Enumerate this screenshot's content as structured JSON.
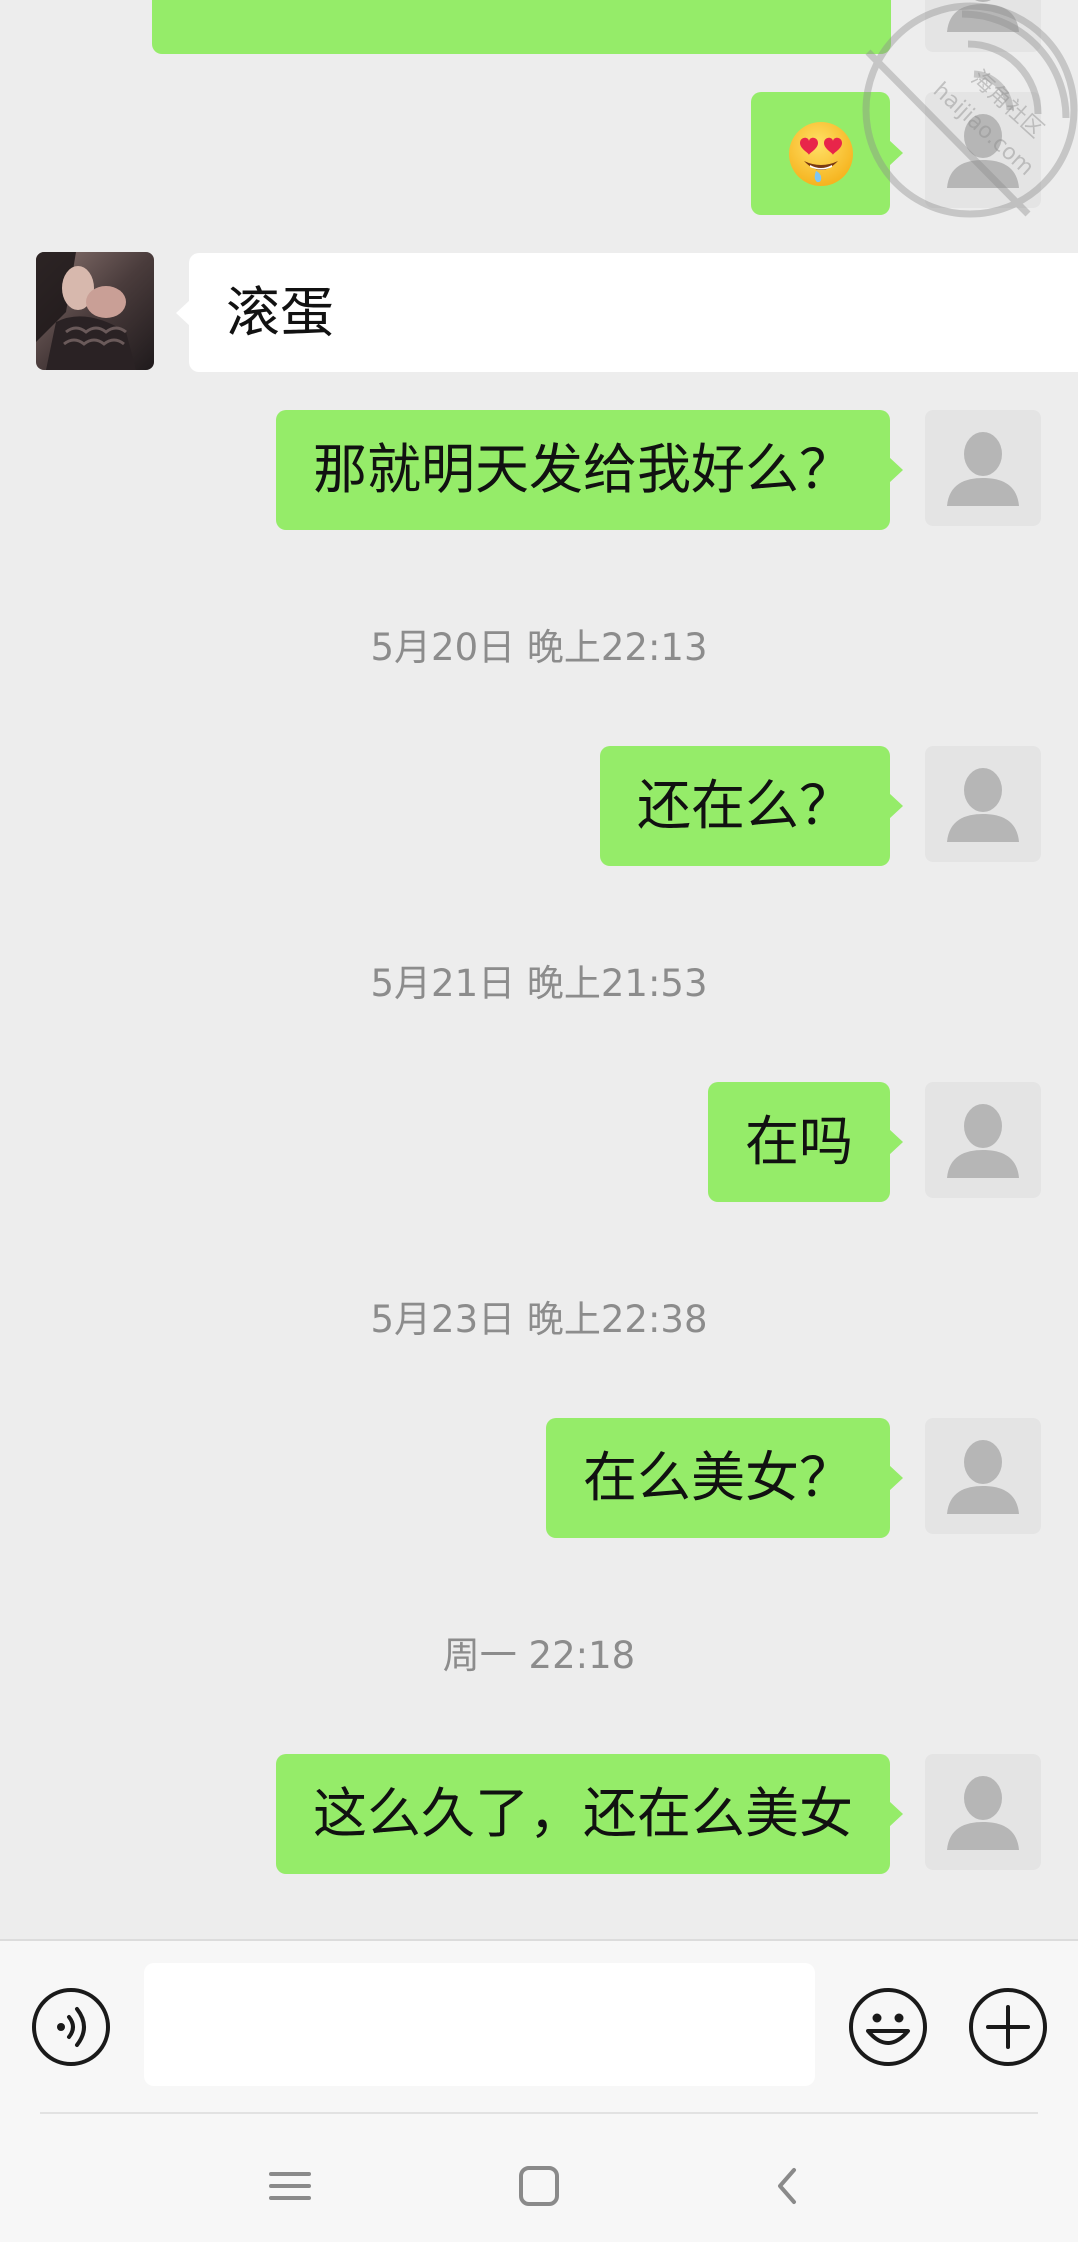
{
  "colors": {
    "background": "#ededed",
    "sent_bubble": "#95ec69",
    "received_bubble": "#ffffff",
    "timestamp": "#8c8c8c",
    "input_bar": "#f7f7f7"
  },
  "chat": {
    "messages": [
      {
        "side": "right",
        "type": "sticker",
        "icon": "heart-eyes-drool-emoji"
      },
      {
        "side": "left",
        "type": "text",
        "text": "滚蛋"
      },
      {
        "side": "right",
        "type": "text",
        "text": "那就明天发给我好么？"
      },
      {
        "type": "time",
        "text": "5月20日 晚上22:13"
      },
      {
        "side": "right",
        "type": "text",
        "text": "还在么？"
      },
      {
        "type": "time",
        "text": "5月21日 晚上21:53"
      },
      {
        "side": "right",
        "type": "text",
        "text": "在吗"
      },
      {
        "type": "time",
        "text": "5月23日 晚上22:38"
      },
      {
        "side": "right",
        "type": "text",
        "text": "在么美女？"
      },
      {
        "type": "time",
        "text": "周一 22:18"
      },
      {
        "side": "right",
        "type": "text",
        "text": "这么久了，还在么美女"
      }
    ],
    "avatars": {
      "self": "default-avatar-icon",
      "contact": "contact-photo-avatar"
    }
  },
  "input_bar": {
    "value": "",
    "icons": [
      "voice-icon",
      "emoji-icon",
      "plus-icon"
    ]
  },
  "nav_bar": {
    "icons": [
      "menu-icon",
      "home-icon",
      "back-icon"
    ]
  },
  "watermark": {
    "text_cn": "海角社区",
    "text_en": "haijiao.com"
  }
}
